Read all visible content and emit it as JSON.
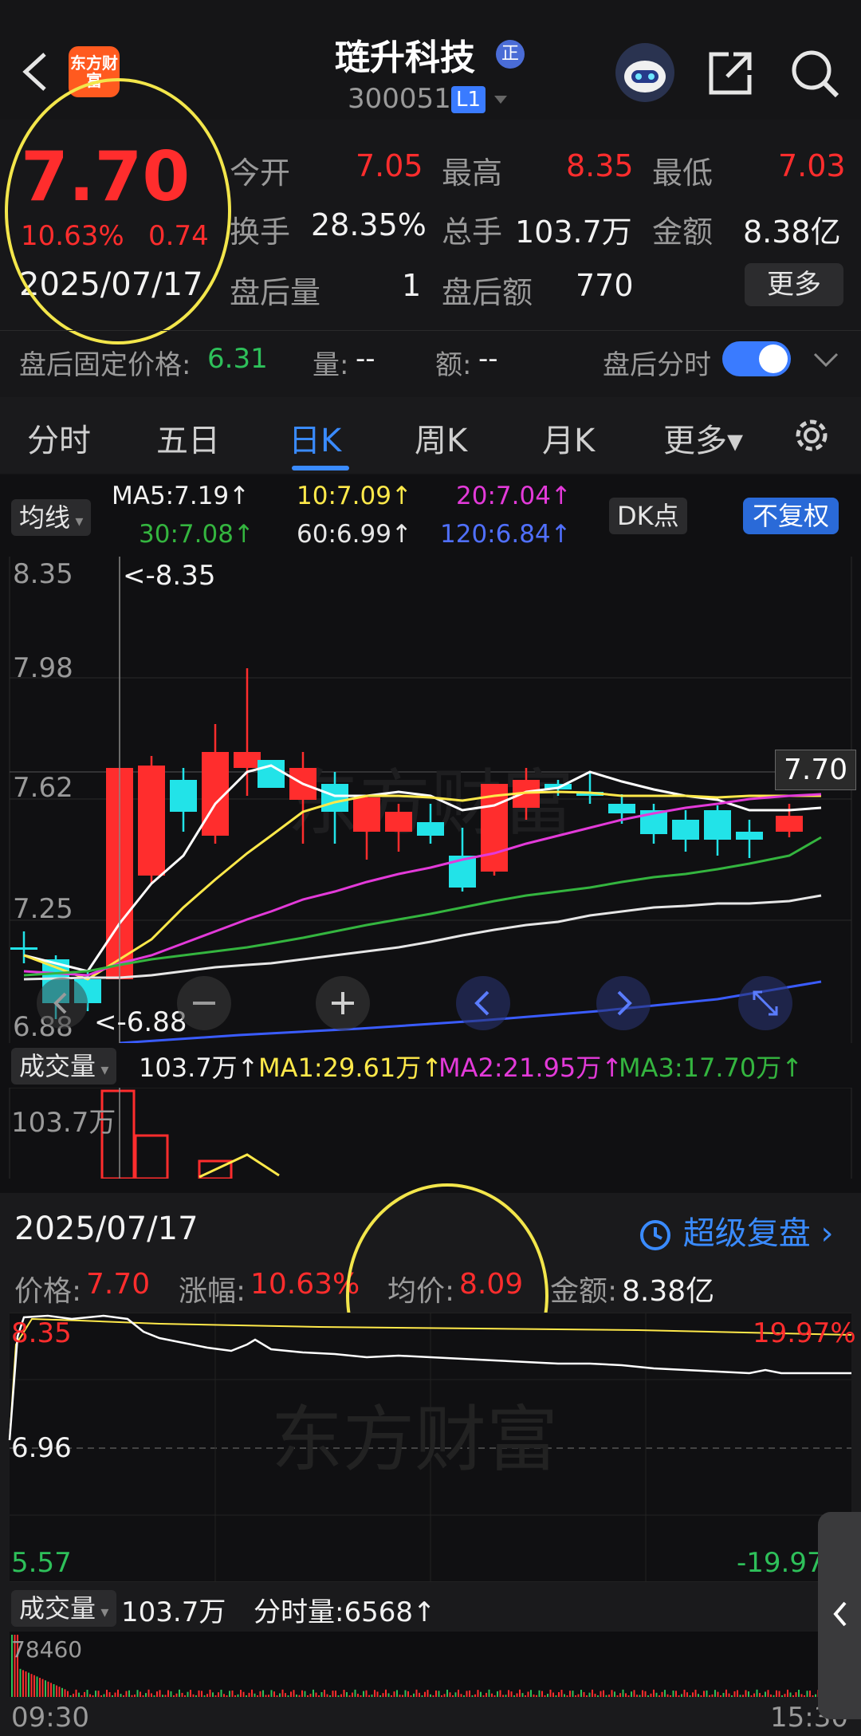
{
  "header": {
    "stock_name": "琏升科技",
    "badge": "正",
    "code": "300051",
    "level": "L1",
    "logo_text": "东方财富"
  },
  "quote": {
    "price": "7.70",
    "change_pct": "10.63%",
    "change_amt": "0.74",
    "date": "2025/07/17",
    "open_label": "今开",
    "open": "7.05",
    "high_label": "最高",
    "high": "8.35",
    "low_label": "最低",
    "low": "7.03",
    "turnover_label": "换手",
    "turnover": "28.35%",
    "volume_label": "总手",
    "volume": "103.7万",
    "amount_label": "金额",
    "amount": "8.38亿",
    "after_vol_label": "盘后量",
    "after_vol": "1",
    "after_amt_label": "盘后额",
    "after_amt": "770",
    "more_btn": "更多",
    "after_fixed_label": "盘后固定价格:",
    "after_fixed": "6.31",
    "qty_label": "量:",
    "qty": "--",
    "amt_label": "额:",
    "amt": "--",
    "after_time_label": "盘后分时"
  },
  "tabs": [
    "分时",
    "五日",
    "日K",
    "周K",
    "月K",
    "更多▾"
  ],
  "ma_bar": {
    "avg_label": "均线",
    "ma5": "MA5:7.19↑",
    "ma10": "10:7.09↑",
    "ma20": "20:7.04↑",
    "ma30": "30:7.08↑",
    "ma60": "60:6.99↑",
    "ma120": "120:6.84↑",
    "dk": "DK点",
    "fq": "不复权"
  },
  "kline": {
    "y_labels": [
      "8.35",
      "7.98",
      "7.62",
      "7.25",
      "6.88"
    ],
    "max_marker": "<-8.35",
    "min_marker": "<-6.88",
    "last_price": "7.70",
    "watermark": "东方财富"
  },
  "volume_bar": {
    "label": "成交量",
    "value": "103.7万↑",
    "ma1": "MA1:29.61万↑",
    "ma2": "MA2:21.95万↑",
    "ma3": "MA3:17.70万↑",
    "axis": "103.7万"
  },
  "intraday": {
    "date": "2025/07/17",
    "replay": "超级复盘",
    "price_label": "价格:",
    "price": "7.70",
    "chg_label": "涨幅:",
    "chg": "10.63%",
    "avg_label": "均价:",
    "avg": "8.09",
    "amount_label": "金额:",
    "amount": "8.38亿",
    "top": "8.35",
    "mid": "6.96",
    "bottom": "5.57",
    "top_pct": "19.97%",
    "bottom_pct": "-19.97",
    "watermark": "东方财富",
    "vol_label": "成交量",
    "vol": "103.7万",
    "tick_label": "分时量:6568↑",
    "vol_axis": "78460",
    "time_start": "09:30",
    "time_end": "15:30"
  },
  "colors": {
    "up": "#ff2d2d",
    "down": "#22e3e8",
    "ma5": "#ffffff",
    "ma10": "#ffe94a",
    "ma20": "#e33ad9",
    "ma30": "#34b53f",
    "ma60": "#e6e6e6",
    "ma120": "#3a5cff"
  }
}
